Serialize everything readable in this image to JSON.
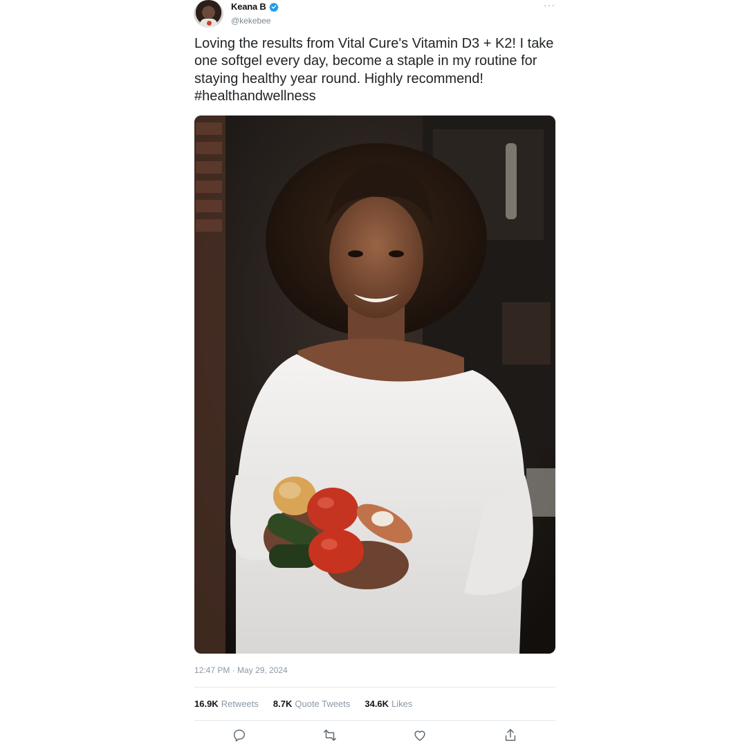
{
  "author": {
    "display_name": "Keana B",
    "handle": "@kekebee",
    "verified": true,
    "verified_color": "#1d9bf0"
  },
  "menu": {
    "more_label": "···"
  },
  "tweet": {
    "text": "Loving the results from Vital Cure's Vitamin D3 + K2! I take one softgel every day, become a staple in my routine for staying healthy year round. Highly recommend! #healthandwellness",
    "timestamp": "12:47 PM · May 29, 2024"
  },
  "stats": [
    {
      "value": "16.9K",
      "label": "Retweets"
    },
    {
      "value": "8.7K",
      "label": "Quote Tweets"
    },
    {
      "value": "34.6K",
      "label": "Likes"
    }
  ],
  "actions": {
    "reply_icon": "reply-icon",
    "retweet_icon": "retweet-icon",
    "like_icon": "like-icon",
    "share_icon": "share-icon"
  },
  "colors": {
    "text_primary": "#0f1419",
    "text_secondary": "#8b98a5",
    "divider": "#e3e7ea"
  }
}
